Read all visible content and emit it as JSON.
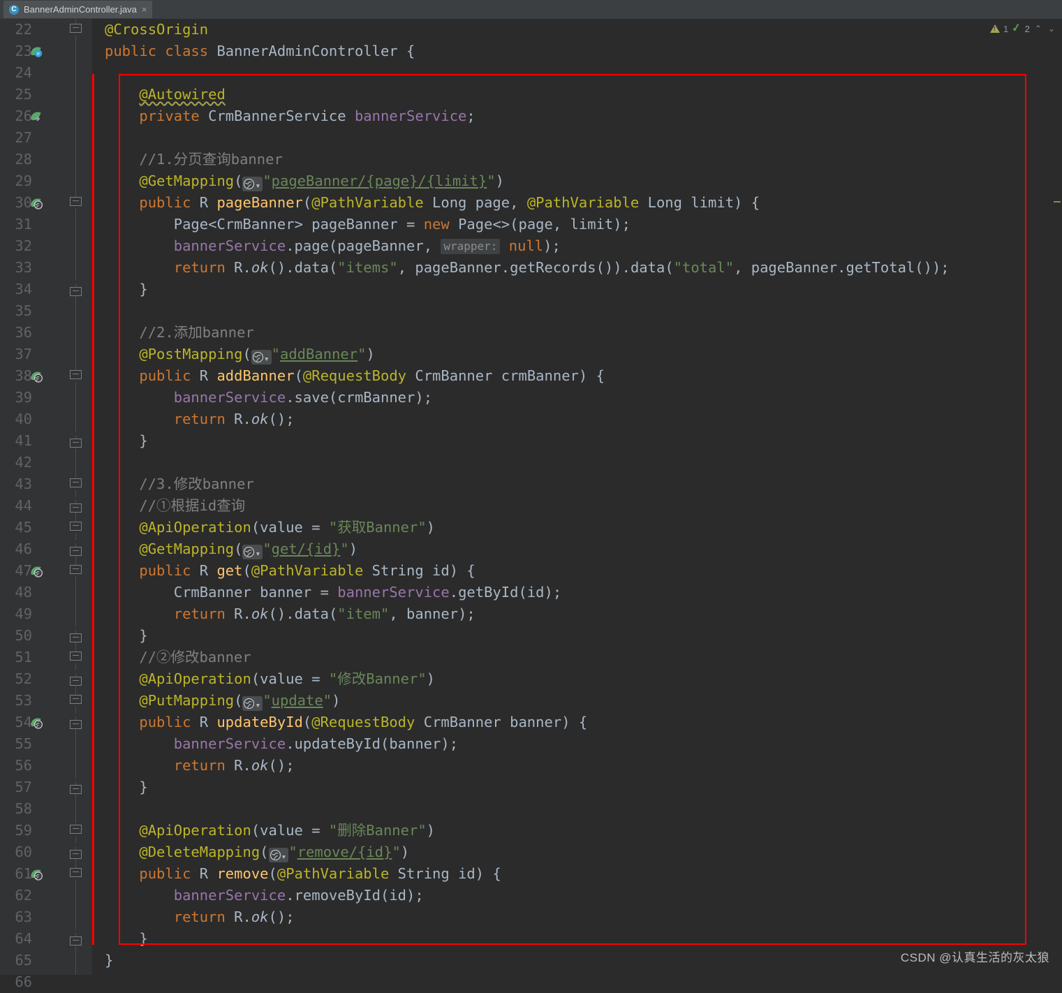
{
  "tab": {
    "icon": "java-class-icon",
    "title": "BannerAdminController.java",
    "close": "×"
  },
  "inspection_widget": {
    "warning_icon": "warning-triangle-icon",
    "warning_count": "1",
    "ok_icon": "inspection-ok-icon",
    "ok_count": "2",
    "prev_icon": "⌃",
    "next_icon": "⌄"
  },
  "watermark": "CSDN @认真生活的灰太狼",
  "colors": {
    "editor_background": "#2b2b2b",
    "gutter_background": "#313335",
    "tabbar_background": "#3c3f41",
    "tab_active_background": "#4e5254",
    "keyword": "#cc7832",
    "annotation": "#bbb529",
    "string": "#6a8759",
    "comment": "#808080",
    "method": "#ffc66d",
    "field": "#9876aa",
    "text": "#a9b7c6",
    "highlight_rectangle": "#ff0000",
    "line_number": "#606366"
  },
  "editor": {
    "language": "java",
    "first_visible_line": 22,
    "last_visible_line": 66,
    "lines": [
      {
        "n": 22,
        "text": "@CrossOrigin"
      },
      {
        "n": 23,
        "text": "public class BannerAdminController {"
      },
      {
        "n": 24,
        "text": ""
      },
      {
        "n": 25,
        "text": "    @Autowired"
      },
      {
        "n": 26,
        "text": "    private CrmBannerService bannerService;"
      },
      {
        "n": 27,
        "text": ""
      },
      {
        "n": 28,
        "text": "    //1.分页查询banner"
      },
      {
        "n": 29,
        "text": "    @GetMapping(\"pageBanner/{page}/{limit}\")"
      },
      {
        "n": 30,
        "text": "    public R pageBanner(@PathVariable Long page, @PathVariable Long limit) {"
      },
      {
        "n": 31,
        "text": "        Page<CrmBanner> pageBanner = new Page<>(page, limit);"
      },
      {
        "n": 32,
        "text": "        bannerService.page(pageBanner, wrapper: null);"
      },
      {
        "n": 33,
        "text": "        return R.ok().data(\"items\", pageBanner.getRecords()).data(\"total\", pageBanner.getTotal());"
      },
      {
        "n": 34,
        "text": "    }"
      },
      {
        "n": 35,
        "text": ""
      },
      {
        "n": 36,
        "text": "    //2.添加banner"
      },
      {
        "n": 37,
        "text": "    @PostMapping(\"addBanner\")"
      },
      {
        "n": 38,
        "text": "    public R addBanner(@RequestBody CrmBanner crmBanner) {"
      },
      {
        "n": 39,
        "text": "        bannerService.save(crmBanner);"
      },
      {
        "n": 40,
        "text": "        return R.ok();"
      },
      {
        "n": 41,
        "text": "    }"
      },
      {
        "n": 42,
        "text": ""
      },
      {
        "n": 43,
        "text": "    //3.修改banner"
      },
      {
        "n": 44,
        "text": "    //①根据id查询"
      },
      {
        "n": 45,
        "text": "    @ApiOperation(value = \"获取Banner\")"
      },
      {
        "n": 46,
        "text": "    @GetMapping(\"get/{id}\")"
      },
      {
        "n": 47,
        "text": "    public R get(@PathVariable String id) {"
      },
      {
        "n": 48,
        "text": "        CrmBanner banner = bannerService.getById(id);"
      },
      {
        "n": 49,
        "text": "        return R.ok().data(\"item\", banner);"
      },
      {
        "n": 50,
        "text": "    }"
      },
      {
        "n": 51,
        "text": "    //②修改banner"
      },
      {
        "n": 52,
        "text": "    @ApiOperation(value = \"修改Banner\")"
      },
      {
        "n": 53,
        "text": "    @PutMapping(\"update\")"
      },
      {
        "n": 54,
        "text": "    public R updateById(@RequestBody CrmBanner banner) {"
      },
      {
        "n": 55,
        "text": "        bannerService.updateById(banner);"
      },
      {
        "n": 56,
        "text": "        return R.ok();"
      },
      {
        "n": 57,
        "text": "    }"
      },
      {
        "n": 58,
        "text": ""
      },
      {
        "n": 59,
        "text": "    @ApiOperation(value = \"删除Banner\")"
      },
      {
        "n": 60,
        "text": "    @DeleteMapping(\"remove/{id}\")"
      },
      {
        "n": 61,
        "text": "    public R remove(@PathVariable String id) {"
      },
      {
        "n": 62,
        "text": "        bannerService.removeById(id);"
      },
      {
        "n": 63,
        "text": "        return R.ok();"
      },
      {
        "n": 64,
        "text": "    }"
      },
      {
        "n": 65,
        "text": "}"
      },
      {
        "n": 66,
        "text": ""
      }
    ],
    "gutter_icons": [
      {
        "line": 23,
        "icon": "spring-bean-icon"
      },
      {
        "line": 26,
        "icon": "spring-autowired-arrow-icon"
      },
      {
        "line": 30,
        "icon": "spring-request-mapping-icon"
      },
      {
        "line": 38,
        "icon": "spring-request-mapping-icon"
      },
      {
        "line": 47,
        "icon": "spring-request-mapping-icon"
      },
      {
        "line": 54,
        "icon": "spring-request-mapping-icon"
      },
      {
        "line": 61,
        "icon": "spring-request-mapping-icon"
      }
    ],
    "inlay_hints": [
      {
        "line": 32,
        "text": "wrapper:"
      }
    ],
    "url_mapping_chips": [
      {
        "line": 29,
        "value": "pageBanner/{page}/{limit}"
      },
      {
        "line": 37,
        "value": "addBanner"
      },
      {
        "line": 46,
        "value": "get/{id}"
      },
      {
        "line": 53,
        "value": "update"
      },
      {
        "line": 60,
        "value": "remove/{id}"
      }
    ]
  }
}
